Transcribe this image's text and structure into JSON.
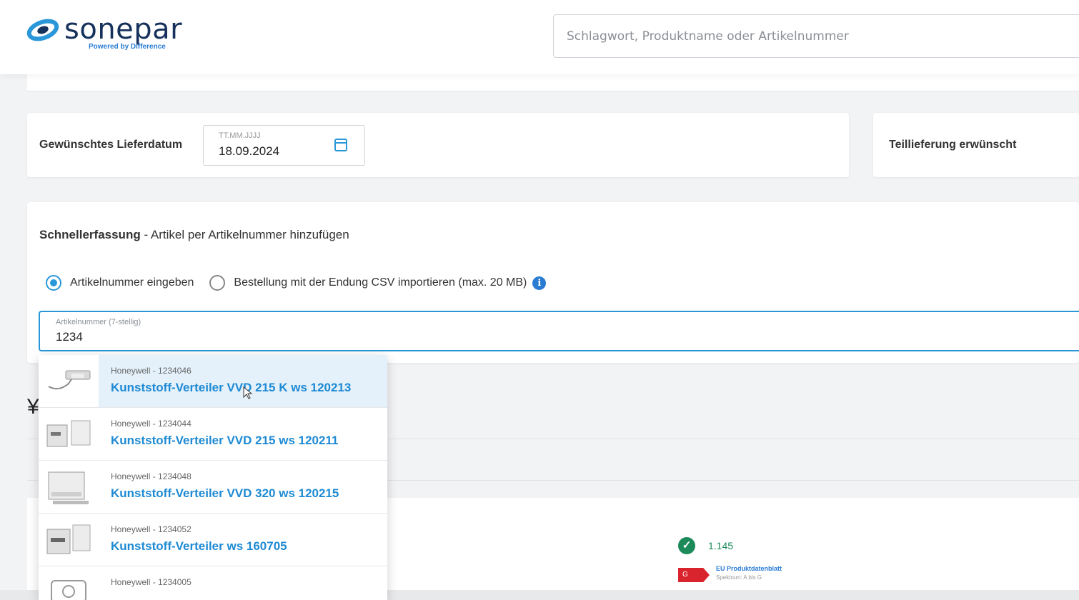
{
  "header": {
    "logo_text": "sonepar",
    "logo_sub": "Powered by Difference",
    "search_placeholder": "Schlagwort, Produktname oder Artikelnummer"
  },
  "delivery": {
    "date_label": "Gewünschtes Lieferdatum",
    "date_placeholder": "TT.MM.JJJJ",
    "date_value": "18.09.2024",
    "partial_label": "Teillieferung erwünscht"
  },
  "quick_entry": {
    "title_bold": "Schnellerfassung",
    "title_rest": " - Artikel per Artikelnummer hinzufügen",
    "radio_manual": "Artikelnummer eingeben",
    "radio_csv": "Bestellung mit der Endung CSV importieren (max. 20 MB)",
    "info_glyph": "i",
    "input_label": "Artikelnummer (7-stellig)",
    "input_value": "1234"
  },
  "suggestions": [
    {
      "meta": "Honeywell - 1234046",
      "name": "Kunststoff-Verteiler VVD 215 K ws 120213",
      "icon": "wall-box-icon",
      "highlighted": true
    },
    {
      "meta": "Honeywell - 1234044",
      "name": "Kunststoff-Verteiler VVD 215 ws 120211",
      "icon": "distribution-box-icon",
      "highlighted": false
    },
    {
      "meta": "Honeywell - 1234048",
      "name": "Kunststoff-Verteiler VVD 320 ws 120215",
      "icon": "distribution-box-icon",
      "highlighted": false
    },
    {
      "meta": "Honeywell - 1234052",
      "name": "Kunststoff-Verteiler ws 160705",
      "icon": "distribution-box-icon",
      "highlighted": false
    },
    {
      "meta": "Honeywell - 1234005",
      "name": "",
      "icon": "camera-icon",
      "highlighted": false
    }
  ],
  "product_row": {
    "stock_value": "1.145",
    "eu_label": "EU Produktdatenblatt",
    "eu_sub": "Spektrum: A bis G",
    "tag_text": "G"
  },
  "colors": {
    "accent": "#2a97d8",
    "link": "#1e8ad3",
    "brand": "#16325c",
    "stock_green": "#1d8a5a",
    "energy_red": "#d9232d"
  }
}
